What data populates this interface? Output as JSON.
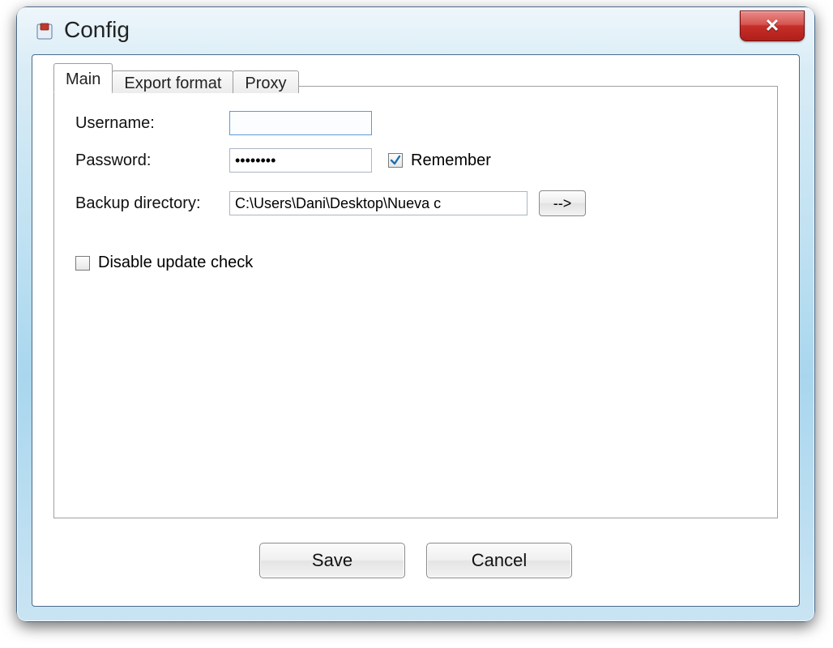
{
  "window": {
    "title": "Config"
  },
  "tabs": {
    "main": "Main",
    "export": "Export format",
    "proxy": "Proxy",
    "active": "main"
  },
  "form": {
    "username_label": "Username:",
    "username_value": "",
    "password_label": "Password:",
    "password_value": "********",
    "remember_label": "Remember",
    "remember_checked": true,
    "backup_label": "Backup directory:",
    "backup_value": "C:\\Users\\Dani\\Desktop\\Nueva c",
    "browse_label": "-->",
    "disable_update_label": "Disable update check",
    "disable_update_checked": false
  },
  "buttons": {
    "save": "Save",
    "cancel": "Cancel"
  }
}
